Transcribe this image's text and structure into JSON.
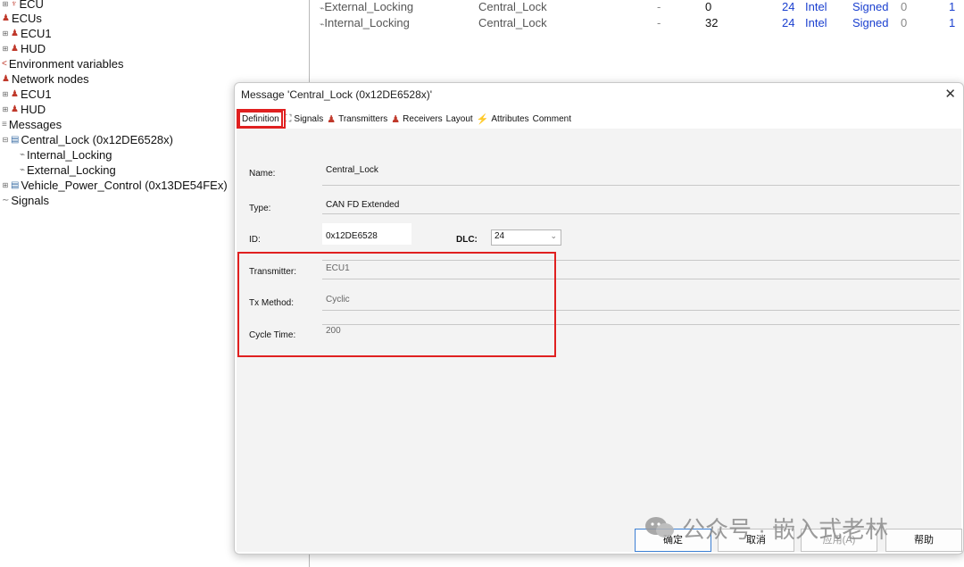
{
  "tree": {
    "items": [
      {
        "label": "ECU",
        "twisty": "⊞"
      },
      {
        "label": "ECUs",
        "twisty": ""
      },
      {
        "label": "ECU1",
        "twisty": "⊞"
      },
      {
        "label": "HUD",
        "twisty": "⊞"
      },
      {
        "label": "Environment variables",
        "twisty": ""
      },
      {
        "label": "Network nodes",
        "twisty": ""
      },
      {
        "label": "ECU1",
        "twisty": "⊞"
      },
      {
        "label": "HUD",
        "twisty": "⊞"
      },
      {
        "label": "Messages",
        "twisty": ""
      },
      {
        "label": "Central_Lock (0x12DE6528x)",
        "twisty": "⊟"
      },
      {
        "label": "Internal_Locking",
        "twisty": ""
      },
      {
        "label": "External_Locking",
        "twisty": ""
      },
      {
        "label": "Vehicle_Power_Control (0x13DE54FEx)",
        "twisty": "⊞"
      },
      {
        "label": "Signals",
        "twisty": ""
      }
    ]
  },
  "signals_table": {
    "rows": [
      {
        "name": "External_Locking",
        "message": "Central_Lock",
        "dash": "-",
        "start": "0",
        "length": "24",
        "order": "Intel",
        "type": "Signed",
        "init": "0",
        "factor": "1"
      },
      {
        "name": "Internal_Locking",
        "message": "Central_Lock",
        "dash": "-",
        "start": "32",
        "length": "24",
        "order": "Intel",
        "type": "Signed",
        "init": "0",
        "factor": "1"
      }
    ]
  },
  "dialog": {
    "title": "Message 'Central_Lock (0x12DE6528x)'",
    "close": "✕",
    "tabs": [
      {
        "label": "Definition",
        "active": true
      },
      {
        "label": "Signals"
      },
      {
        "label": "Transmitters"
      },
      {
        "label": "Receivers"
      },
      {
        "label": "Layout"
      },
      {
        "label": "Attributes"
      },
      {
        "label": "Comment"
      }
    ],
    "fields": {
      "name_label": "Name:",
      "name_value": "Central_Lock",
      "type_label": "Type:",
      "type_value": "CAN FD Extended",
      "id_label": "ID:",
      "id_value": "0x12DE6528",
      "dlc_label": "DLC:",
      "dlc_value": "24",
      "transmitter_label": "Transmitter:",
      "transmitter_value": "ECU1",
      "txmethod_label": "Tx Method:",
      "txmethod_value": "Cyclic",
      "cycle_label": "Cycle Time:",
      "cycle_value": "200"
    },
    "buttons": {
      "ok": "确定",
      "cancel": "取消",
      "apply": "应用(A)",
      "help": "帮助"
    }
  },
  "watermark": {
    "text": "公众号 · 嵌入式老林"
  },
  "colors": {
    "highlight": "#e02020",
    "link_blue": "#1a3fcf"
  }
}
